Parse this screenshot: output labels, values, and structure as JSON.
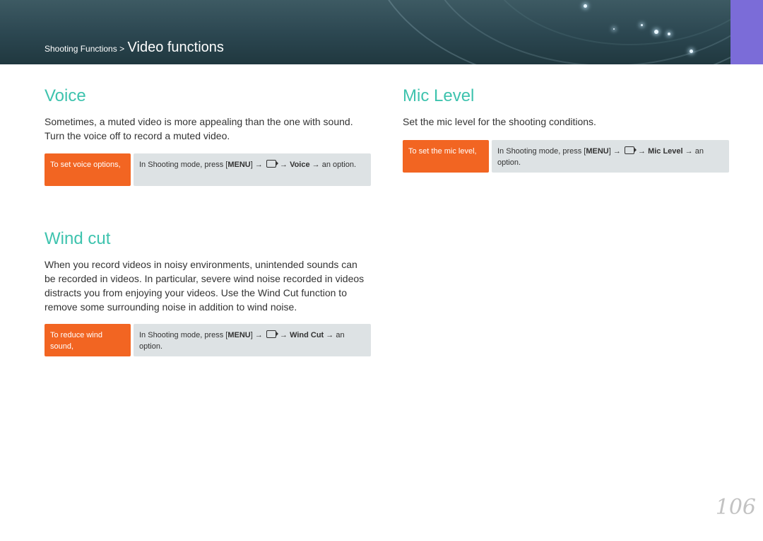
{
  "header": {
    "breadcrumb_parent": "Shooting Functions >",
    "breadcrumb_current": "Video functions",
    "accent_color": "#7b6cd8"
  },
  "colors": {
    "heading": "#3ec3ae",
    "label_box": "#f26522",
    "instruction_box": "#dde2e4"
  },
  "voice": {
    "heading": "Voice",
    "body": "Sometimes, a muted video is more appealing than the one with sound. Turn the voice off to record a muted video.",
    "label": "To set voice options,",
    "instr_prefix": "In Shooting mode, press [",
    "menu_key": "MENU",
    "instr_mid": "] →",
    "icon": "video-mode-icon",
    "arrow": "→",
    "option": "Voice",
    "instr_suffix": "→ an option."
  },
  "wind_cut": {
    "heading": "Wind cut",
    "body": "When you record videos in noisy environments, unintended sounds can be recorded in videos. In particular, severe wind noise recorded in videos distracts you from enjoying your videos. Use the Wind Cut function to remove some surrounding noise in addition to wind noise.",
    "label": "To reduce wind sound,",
    "instr_prefix": "In Shooting mode, press [",
    "menu_key": "MENU",
    "instr_mid": "] →",
    "icon": "video-mode-icon",
    "arrow": "→",
    "option": "Wind Cut",
    "instr_suffix": "→ an option."
  },
  "mic_level": {
    "heading": "Mic Level",
    "body": "Set the mic level for the shooting conditions.",
    "label": "To set the mic level,",
    "instr_prefix": "In Shooting mode, press [",
    "menu_key": "MENU",
    "instr_mid": "] →",
    "icon": "video-mode-icon",
    "arrow": "→",
    "option": "Mic Level",
    "instr_suffix": "→ an option."
  },
  "page_number": "106"
}
